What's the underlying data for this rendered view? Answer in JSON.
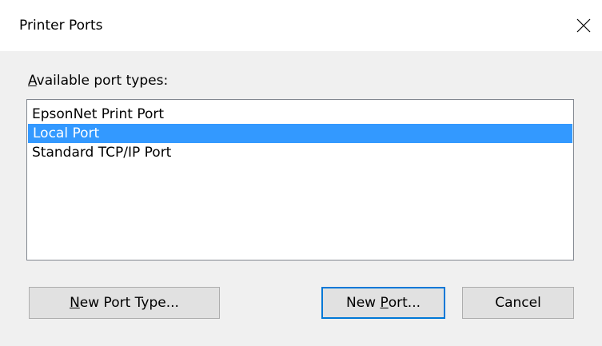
{
  "window": {
    "title": "Printer Ports"
  },
  "available": {
    "label_prefix": "",
    "label_mnemonic": "A",
    "label_rest": "vailable port types:"
  },
  "port_types": [
    {
      "label": "EpsonNet Print Port",
      "selected": false
    },
    {
      "label": "Local Port",
      "selected": true
    },
    {
      "label": "Standard TCP/IP Port",
      "selected": false
    }
  ],
  "buttons": {
    "new_port_type": {
      "prefix": "",
      "mnemonic": "N",
      "rest": "ew Port Type..."
    },
    "new_port": {
      "prefix": "New ",
      "mnemonic": "P",
      "rest": "ort..."
    },
    "cancel": {
      "label": "Cancel"
    }
  },
  "colors": {
    "selection": "#3399ff",
    "default_button_border": "#0078d7",
    "dialog_background": "#f0f0f0"
  },
  "icons": {
    "close": "close-icon"
  }
}
